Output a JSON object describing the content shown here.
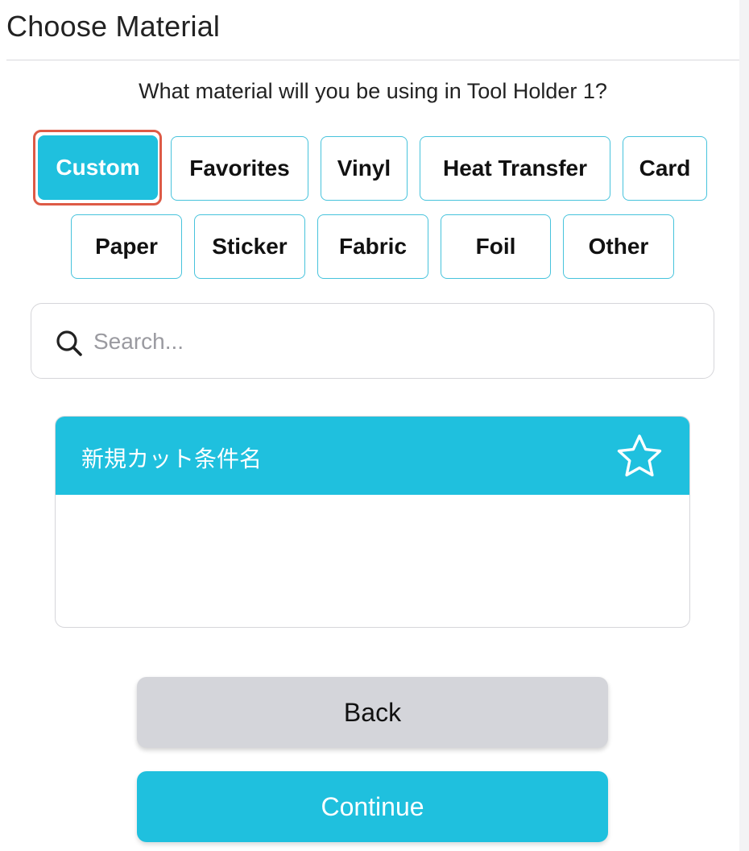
{
  "header": {
    "title": "Choose Material"
  },
  "prompt": {
    "question": "What material will you be using in Tool Holder 1?"
  },
  "tabs": [
    {
      "label": "Custom",
      "active": true
    },
    {
      "label": "Favorites",
      "active": false
    },
    {
      "label": "Vinyl",
      "active": false
    },
    {
      "label": "Heat Transfer",
      "active": false
    },
    {
      "label": "Card",
      "active": false
    },
    {
      "label": "Paper",
      "active": false
    },
    {
      "label": "Sticker",
      "active": false
    },
    {
      "label": "Fabric",
      "active": false
    },
    {
      "label": "Foil",
      "active": false
    },
    {
      "label": "Other",
      "active": false
    }
  ],
  "search": {
    "placeholder": "Search...",
    "value": "",
    "icon": "search-icon"
  },
  "material_card": {
    "title": "新規カット条件名",
    "favorite_icon": "star-outline-icon",
    "favorited": false
  },
  "actions": {
    "back_label": "Back",
    "continue_label": "Continue"
  },
  "colors": {
    "accent": "#1fc0de",
    "tab_border": "#47c3dc",
    "focus_ring": "#dd5a46",
    "back_button": "#d4d5da"
  }
}
